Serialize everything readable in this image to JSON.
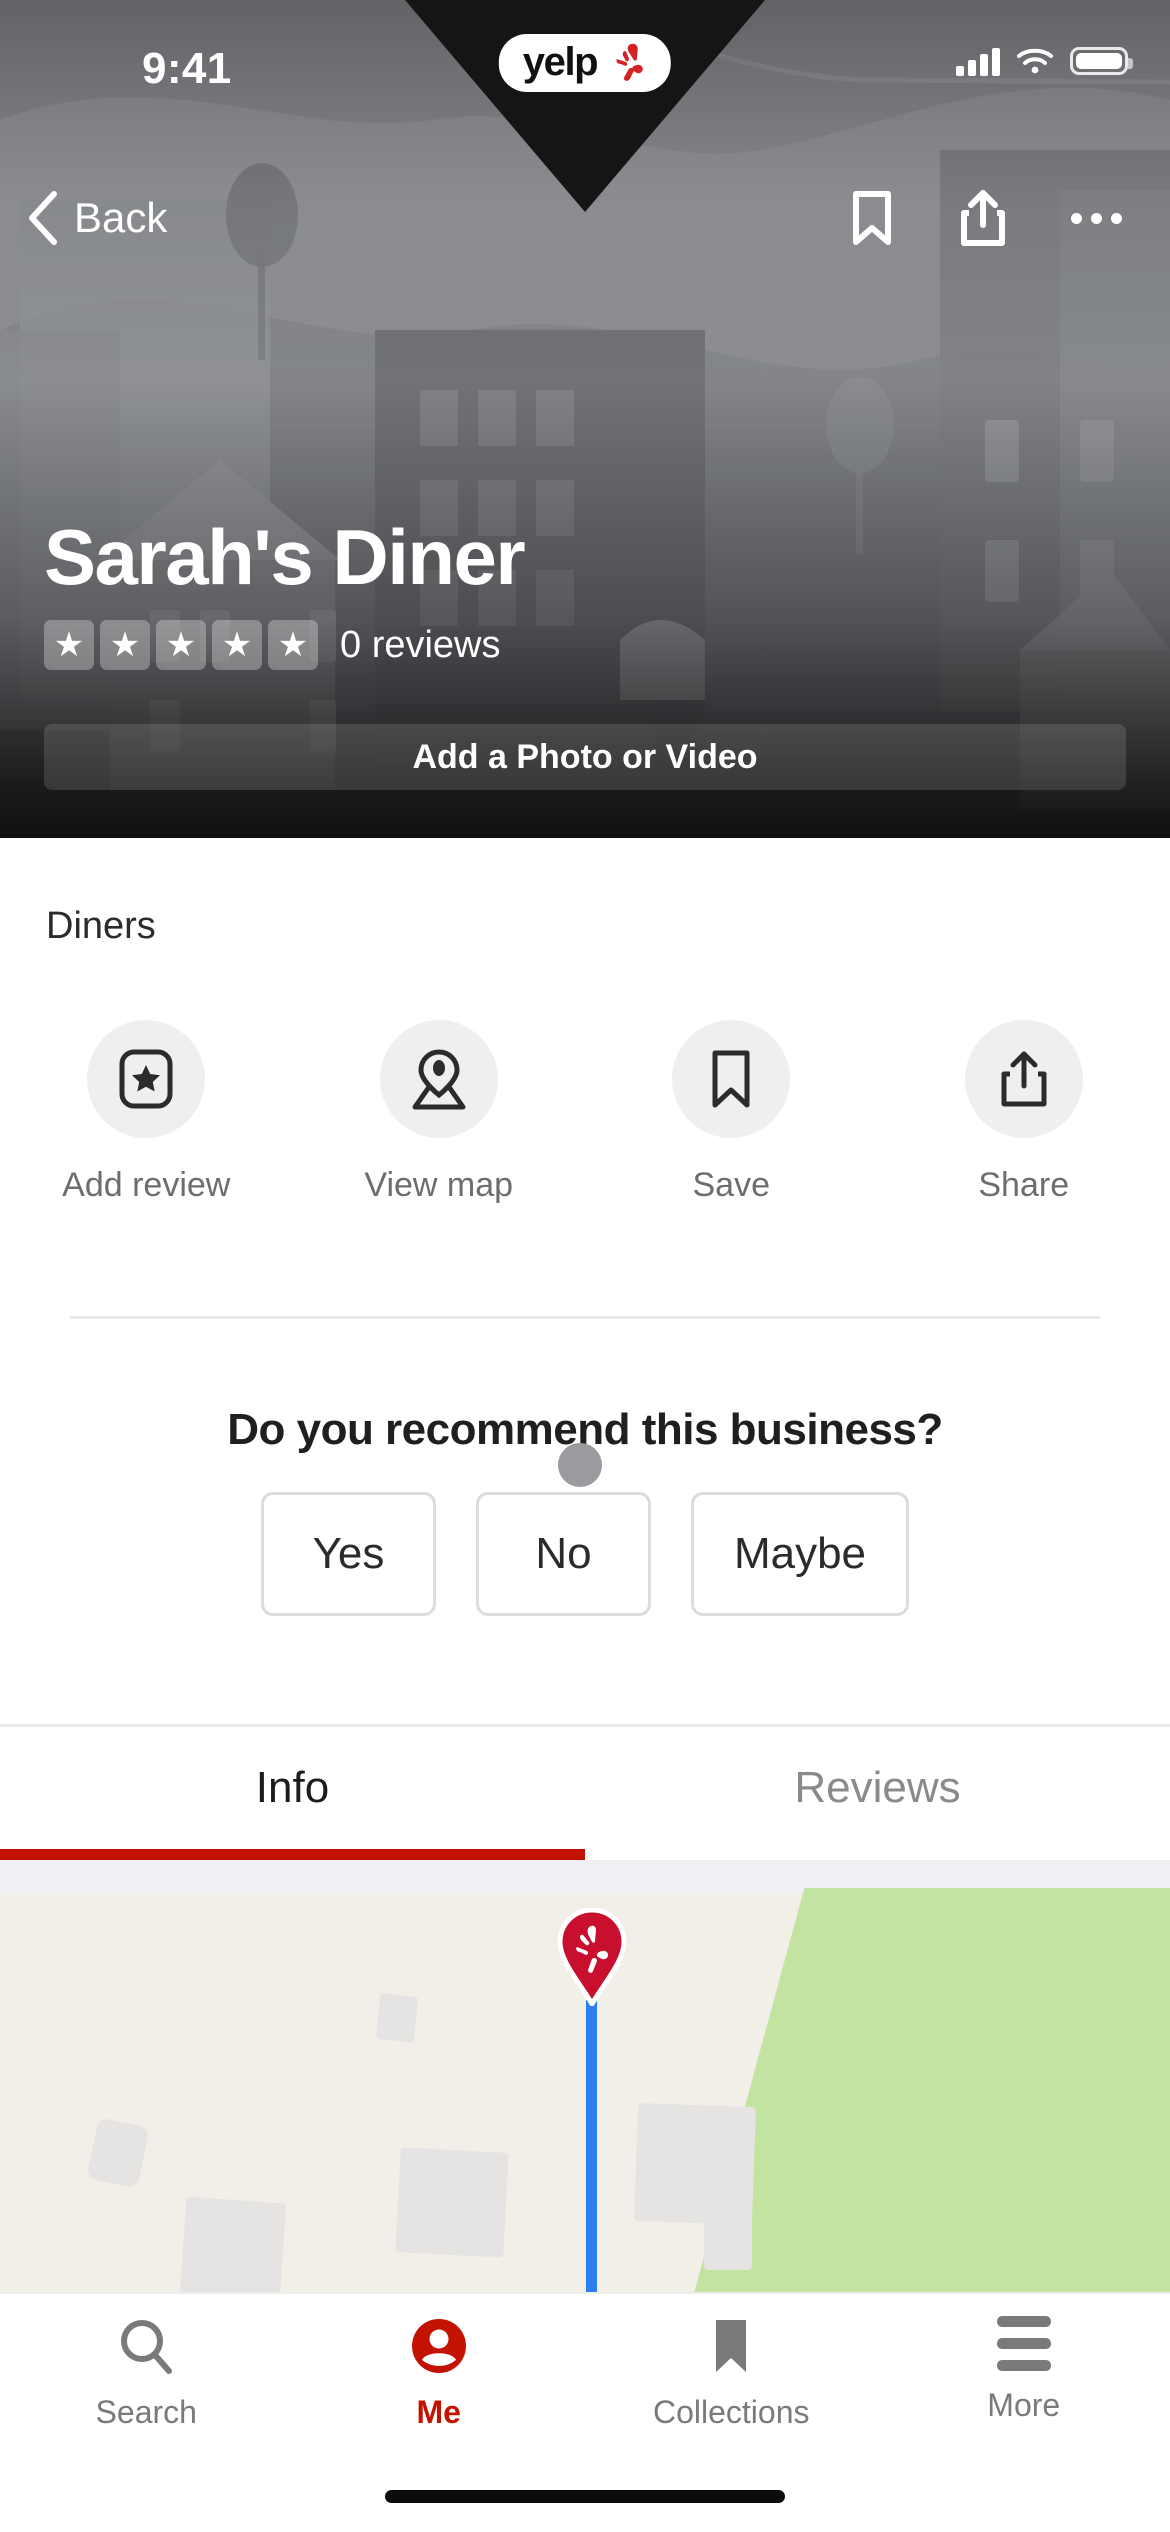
{
  "status_bar": {
    "time": "9:41",
    "brand_logo_text": "yelp",
    "signal_icon": "cellular-signal-icon",
    "wifi_icon": "wifi-icon",
    "battery_icon": "battery-icon"
  },
  "nav_bar": {
    "back_label": "Back",
    "back_icon": "chevron-left-icon",
    "bookmark_icon": "bookmark-icon",
    "share_icon": "share-icon",
    "more_icon": "ellipsis-icon"
  },
  "hero": {
    "business_name": "Sarah's Diner",
    "rating_stars": 5,
    "rating_filled": 0,
    "review_count_label": "0 reviews",
    "add_photo_label": "Add a Photo or Video",
    "star_glyph": "★"
  },
  "business": {
    "category": "Diners"
  },
  "actions": [
    {
      "label": "Add review",
      "icon": "add-review-star-icon"
    },
    {
      "label": "View map",
      "icon": "map-pin-icon"
    },
    {
      "label": "Save",
      "icon": "bookmark-icon"
    },
    {
      "label": "Share",
      "icon": "share-icon"
    }
  ],
  "recommend": {
    "question": "Do you recommend this business?",
    "options": [
      "Yes",
      "No",
      "Maybe"
    ]
  },
  "content_tabs": {
    "items": [
      {
        "label": "Info",
        "active": true
      },
      {
        "label": "Reviews",
        "active": false
      }
    ],
    "active_accent": "#c41200"
  },
  "map": {
    "pin_icon": "yelp-burst-pin-icon",
    "land_color": "#f2efe9",
    "park_color": "#c3e3a0",
    "road_color": "#2f7ef0"
  },
  "bottom_nav": {
    "items": [
      {
        "label": "Search",
        "icon": "search-icon",
        "active": false
      },
      {
        "label": "Me",
        "icon": "profile-icon",
        "active": true
      },
      {
        "label": "Collections",
        "icon": "bookmark-filled-icon",
        "active": false
      },
      {
        "label": "More",
        "icon": "hamburger-menu-icon",
        "active": false
      }
    ],
    "active_color": "#c41200",
    "inactive_color": "#7a7a7a"
  }
}
